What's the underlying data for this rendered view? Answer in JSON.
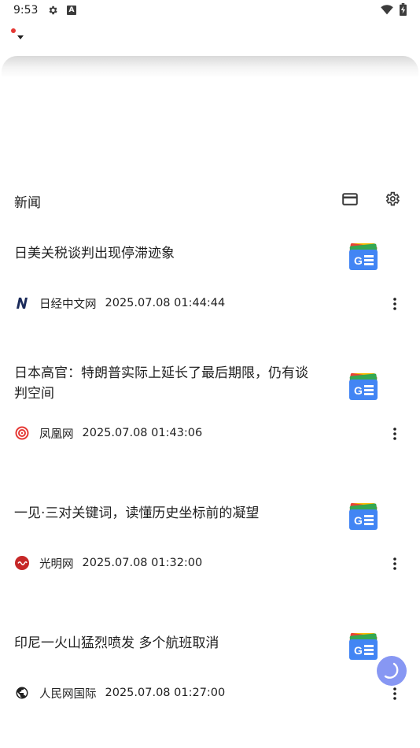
{
  "status_bar": {
    "time": "9:53",
    "icons": [
      "gear-icon",
      "a-badge-icon",
      "wifi-icon",
      "battery-charging-icon"
    ]
  },
  "header": {
    "account_icon": "account-switcher-caret"
  },
  "section": {
    "title": "新闻",
    "icons": [
      "card-view-icon",
      "settings-icon"
    ]
  },
  "news": [
    {
      "title": "日美关税谈判出现停滞迹象",
      "source": "日经中文网",
      "time": "2025.07.08 01:44:44",
      "source_icon": "nikkei-n-icon"
    },
    {
      "title": "日本高官：特朗普实际上延长了最后期限，仍有谈判空间",
      "source": "凤凰网",
      "time": "2025.07.08 01:43:06",
      "source_icon": "ifeng-swirl-icon"
    },
    {
      "title": "一见·三对关键词，读懂历史坐标前的凝望",
      "source": "光明网",
      "time": "2025.07.08 01:32:00",
      "source_icon": "gmw-icon"
    },
    {
      "title": "印尼一火山猛烈喷发 多个航班取消",
      "source": "人民网国际",
      "time": "2025.07.08 01:27:00",
      "source_icon": "globe-icon"
    }
  ],
  "colors": {
    "accent_red": "#e53935",
    "fab": "#7b8cf2",
    "gnews_blue": "#4285f4",
    "gnews_green": "#34a853",
    "gnews_yellow": "#fbbc04",
    "gnews_red": "#ea4335"
  }
}
